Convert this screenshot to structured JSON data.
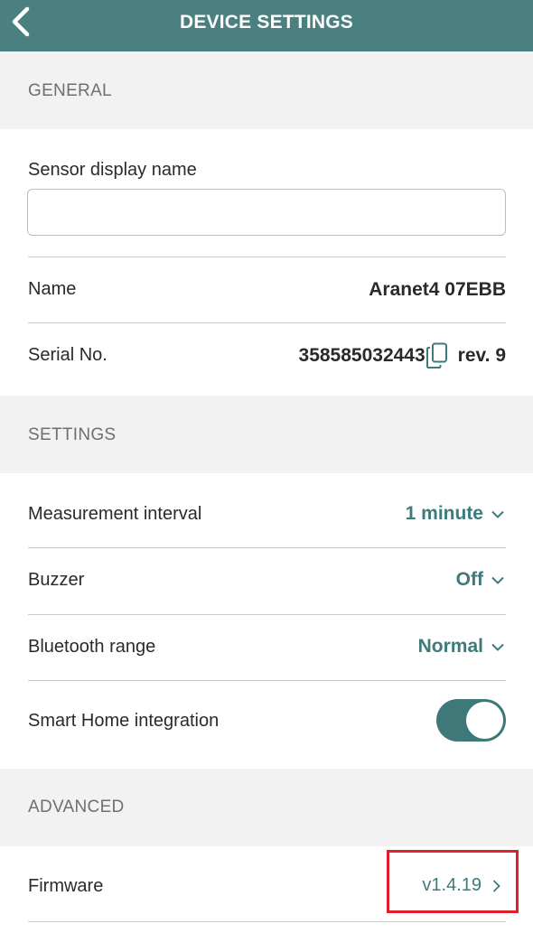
{
  "header": {
    "title": "DEVICE SETTINGS",
    "back_icon": "chevron-left-icon"
  },
  "general": {
    "section_label": "GENERAL",
    "display_name_label": "Sensor display name",
    "display_name_value": "",
    "name_label": "Name",
    "name_value": "Aranet4 07EBB",
    "serial_label": "Serial No.",
    "serial_value": "358585032443",
    "copy_icon": "copy-icon",
    "revision": "rev. 9"
  },
  "settings": {
    "section_label": "SETTINGS",
    "measurement_label": "Measurement interval",
    "measurement_value": "1 minute",
    "buzzer_label": "Buzzer",
    "buzzer_value": "Off",
    "bluetooth_label": "Bluetooth range",
    "bluetooth_value": "Normal",
    "smarthome_label": "Smart Home integration",
    "smarthome_enabled": true
  },
  "advanced": {
    "section_label": "ADVANCED",
    "firmware_label": "Firmware",
    "firmware_value": "v1.4.19"
  },
  "colors": {
    "header": "#4a8080",
    "accent": "#3d7b7b",
    "highlight": "#e0202a"
  }
}
